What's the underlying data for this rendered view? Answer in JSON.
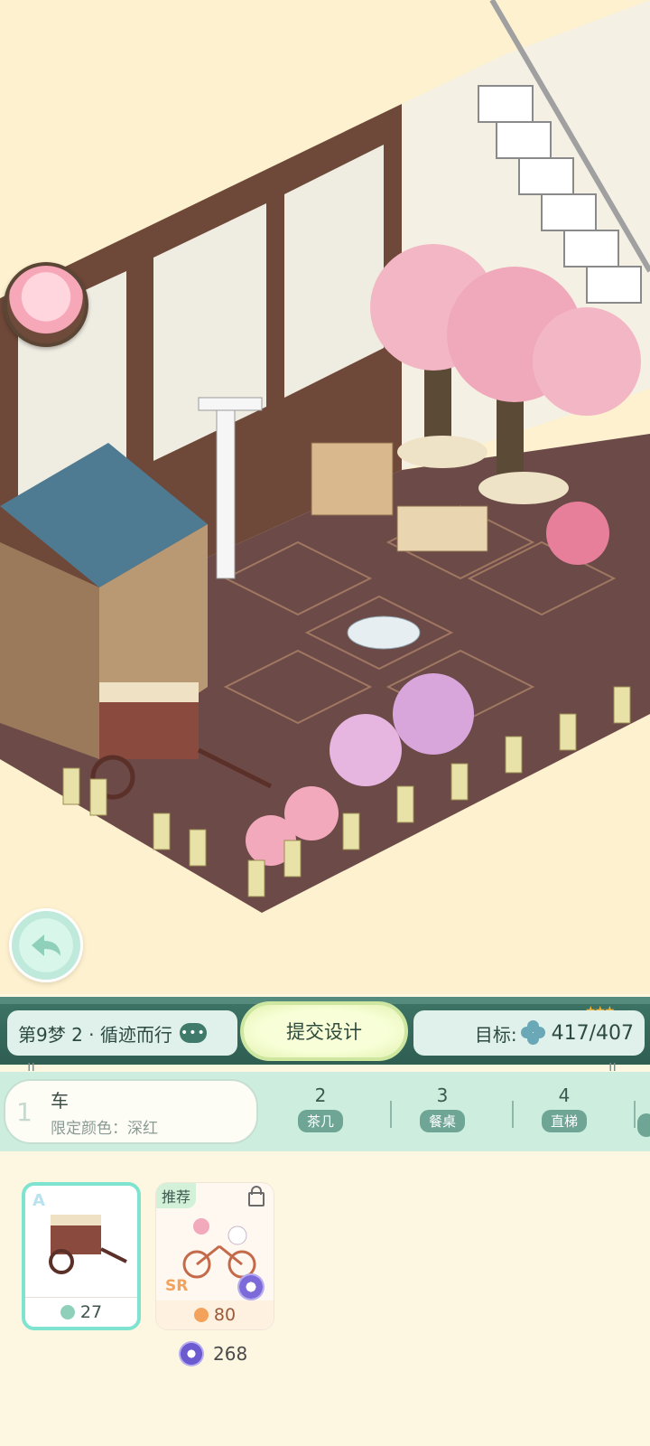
{
  "level": {
    "text": "第9梦 2 · 循迹而行",
    "chat_icon": "•••"
  },
  "submit": {
    "label": "提交设计"
  },
  "target": {
    "label": "目标:",
    "value": "417/407",
    "icon": "clover-icon",
    "stars": "★★★"
  },
  "tabs": {
    "active": {
      "number": "1",
      "title": "车",
      "subtitle": "限定颜色：深红"
    },
    "items": [
      {
        "number": "2",
        "label": "茶几"
      },
      {
        "number": "3",
        "label": "餐桌"
      },
      {
        "number": "4",
        "label": "直梯"
      }
    ]
  },
  "items": [
    {
      "grade": "A",
      "price": "27",
      "selected": true
    },
    {
      "tag": "推荐",
      "grade": "SR",
      "price": "80",
      "locked": true
    }
  ],
  "extra_cost": "268",
  "colors": {
    "header": "#2f5d52",
    "tab_bar": "#cdeede",
    "selected_border": "#7ee3cf",
    "accent_purple": "#7b6ad8"
  }
}
